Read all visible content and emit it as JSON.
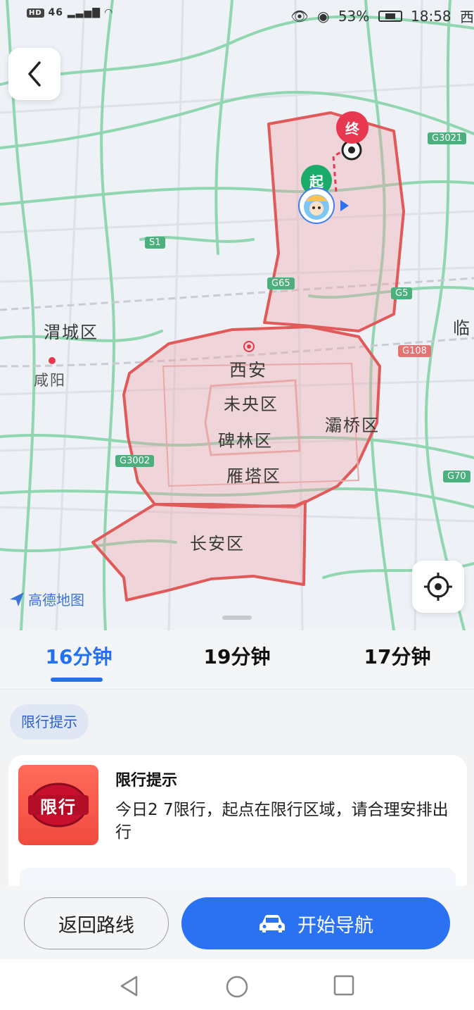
{
  "status_bar": {
    "network": "46",
    "battery_percent": "53%",
    "battery_level": 0.53,
    "time": "18:58",
    "overflow_char": "西"
  },
  "map": {
    "labels": {
      "city": "西安",
      "weicheng": "渭城区",
      "xianyang": "咸阳",
      "weiyang": "未央区",
      "beilin": "碑林区",
      "yanta": "雁塔区",
      "baqiao": "灞桥区",
      "changan": "长安区",
      "lin": "临"
    },
    "road_tags": {
      "s1": "S1",
      "g65": "G65",
      "g5": "G5",
      "g3021": "G3021",
      "g108": "G108",
      "g3002": "G3002",
      "g70": "G70"
    },
    "start_marker": "起",
    "end_marker": "终",
    "watermark": "高德地图",
    "restricted_zone_color": "#e15a5a",
    "road_color": "#7fd0a8"
  },
  "route_tabs": [
    {
      "label": "16分钟",
      "active": true
    },
    {
      "label": "19分钟",
      "active": false
    },
    {
      "label": "17分钟",
      "active": false
    }
  ],
  "chip": {
    "label": "限行提示"
  },
  "notice_card": {
    "icon_text": "限行",
    "title": "限行提示",
    "text": "今日2 7限行，起点在限行区域，请合理安排出行"
  },
  "actions": {
    "back_label": "返回路线",
    "start_label": "开始导航",
    "accent": "#2b72f2"
  }
}
